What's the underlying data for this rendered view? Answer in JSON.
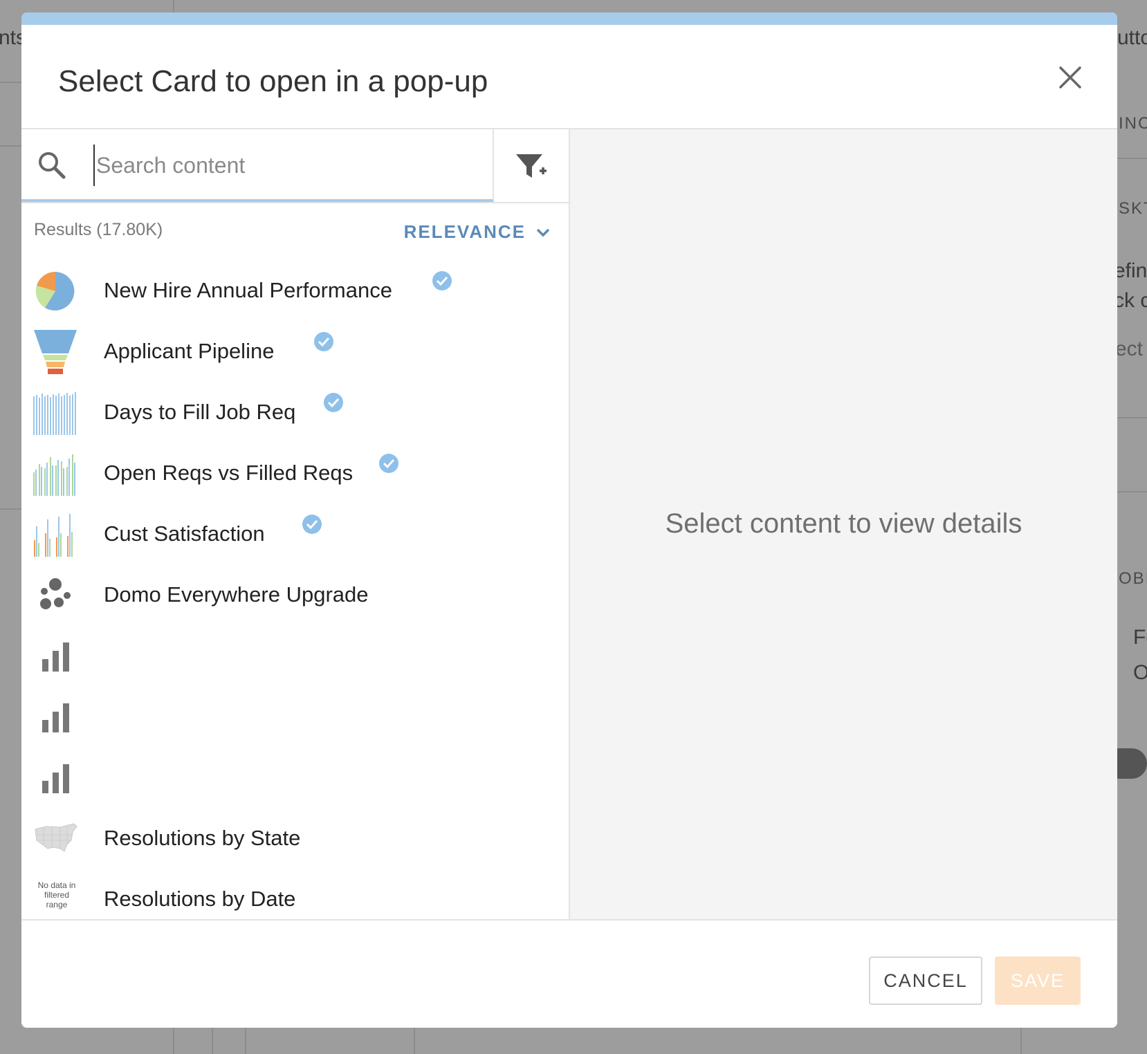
{
  "background": {
    "fragments": [
      "nts",
      "utto",
      "INC",
      "SKT",
      "efin",
      "ck c",
      "ect",
      "OBI",
      "Fo",
      "O"
    ]
  },
  "modal": {
    "title": "Select Card to open in a pop-up",
    "search": {
      "placeholder": "Search content",
      "value": ""
    },
    "results_label": "Results (17.80K)",
    "sort_label": "RELEVANCE",
    "empty_details": "Select content to view details",
    "items": [
      {
        "name": "New Hire Annual Performance",
        "thumb": "pie-chart-icon",
        "verified": true
      },
      {
        "name": "Applicant Pipeline",
        "thumb": "funnel-chart-icon",
        "verified": true
      },
      {
        "name": "Days to Fill Job Req",
        "thumb": "bar-chart-blue-icon",
        "verified": true
      },
      {
        "name": "Open Reqs vs Filled Reqs",
        "thumb": "bar-chart-green-icon",
        "verified": true
      },
      {
        "name": "Cust Satisfaction",
        "thumb": "grouped-bar-chart-icon",
        "verified": true
      },
      {
        "name": "Domo Everywhere Upgrade",
        "thumb": "app-dots-icon",
        "verified": false
      },
      {
        "name": "",
        "thumb": "bar-chart-gray-icon",
        "verified": false
      },
      {
        "name": "",
        "thumb": "bar-chart-gray-icon",
        "verified": false
      },
      {
        "name": "",
        "thumb": "bar-chart-gray-icon",
        "verified": false
      },
      {
        "name": "Resolutions by State",
        "thumb": "us-map-icon",
        "verified": false
      },
      {
        "name": "Resolutions by Date",
        "thumb": "no-data-thumb",
        "verified": false,
        "thumb_text": "No data in filtered range"
      }
    ],
    "footer": {
      "cancel_label": "CANCEL",
      "save_label": "SAVE"
    },
    "colors": {
      "accent": "#a7cbeb",
      "sort": "#5a8ab8",
      "save_disabled": "#fce1c4",
      "verified": "#8ec0ea"
    }
  }
}
